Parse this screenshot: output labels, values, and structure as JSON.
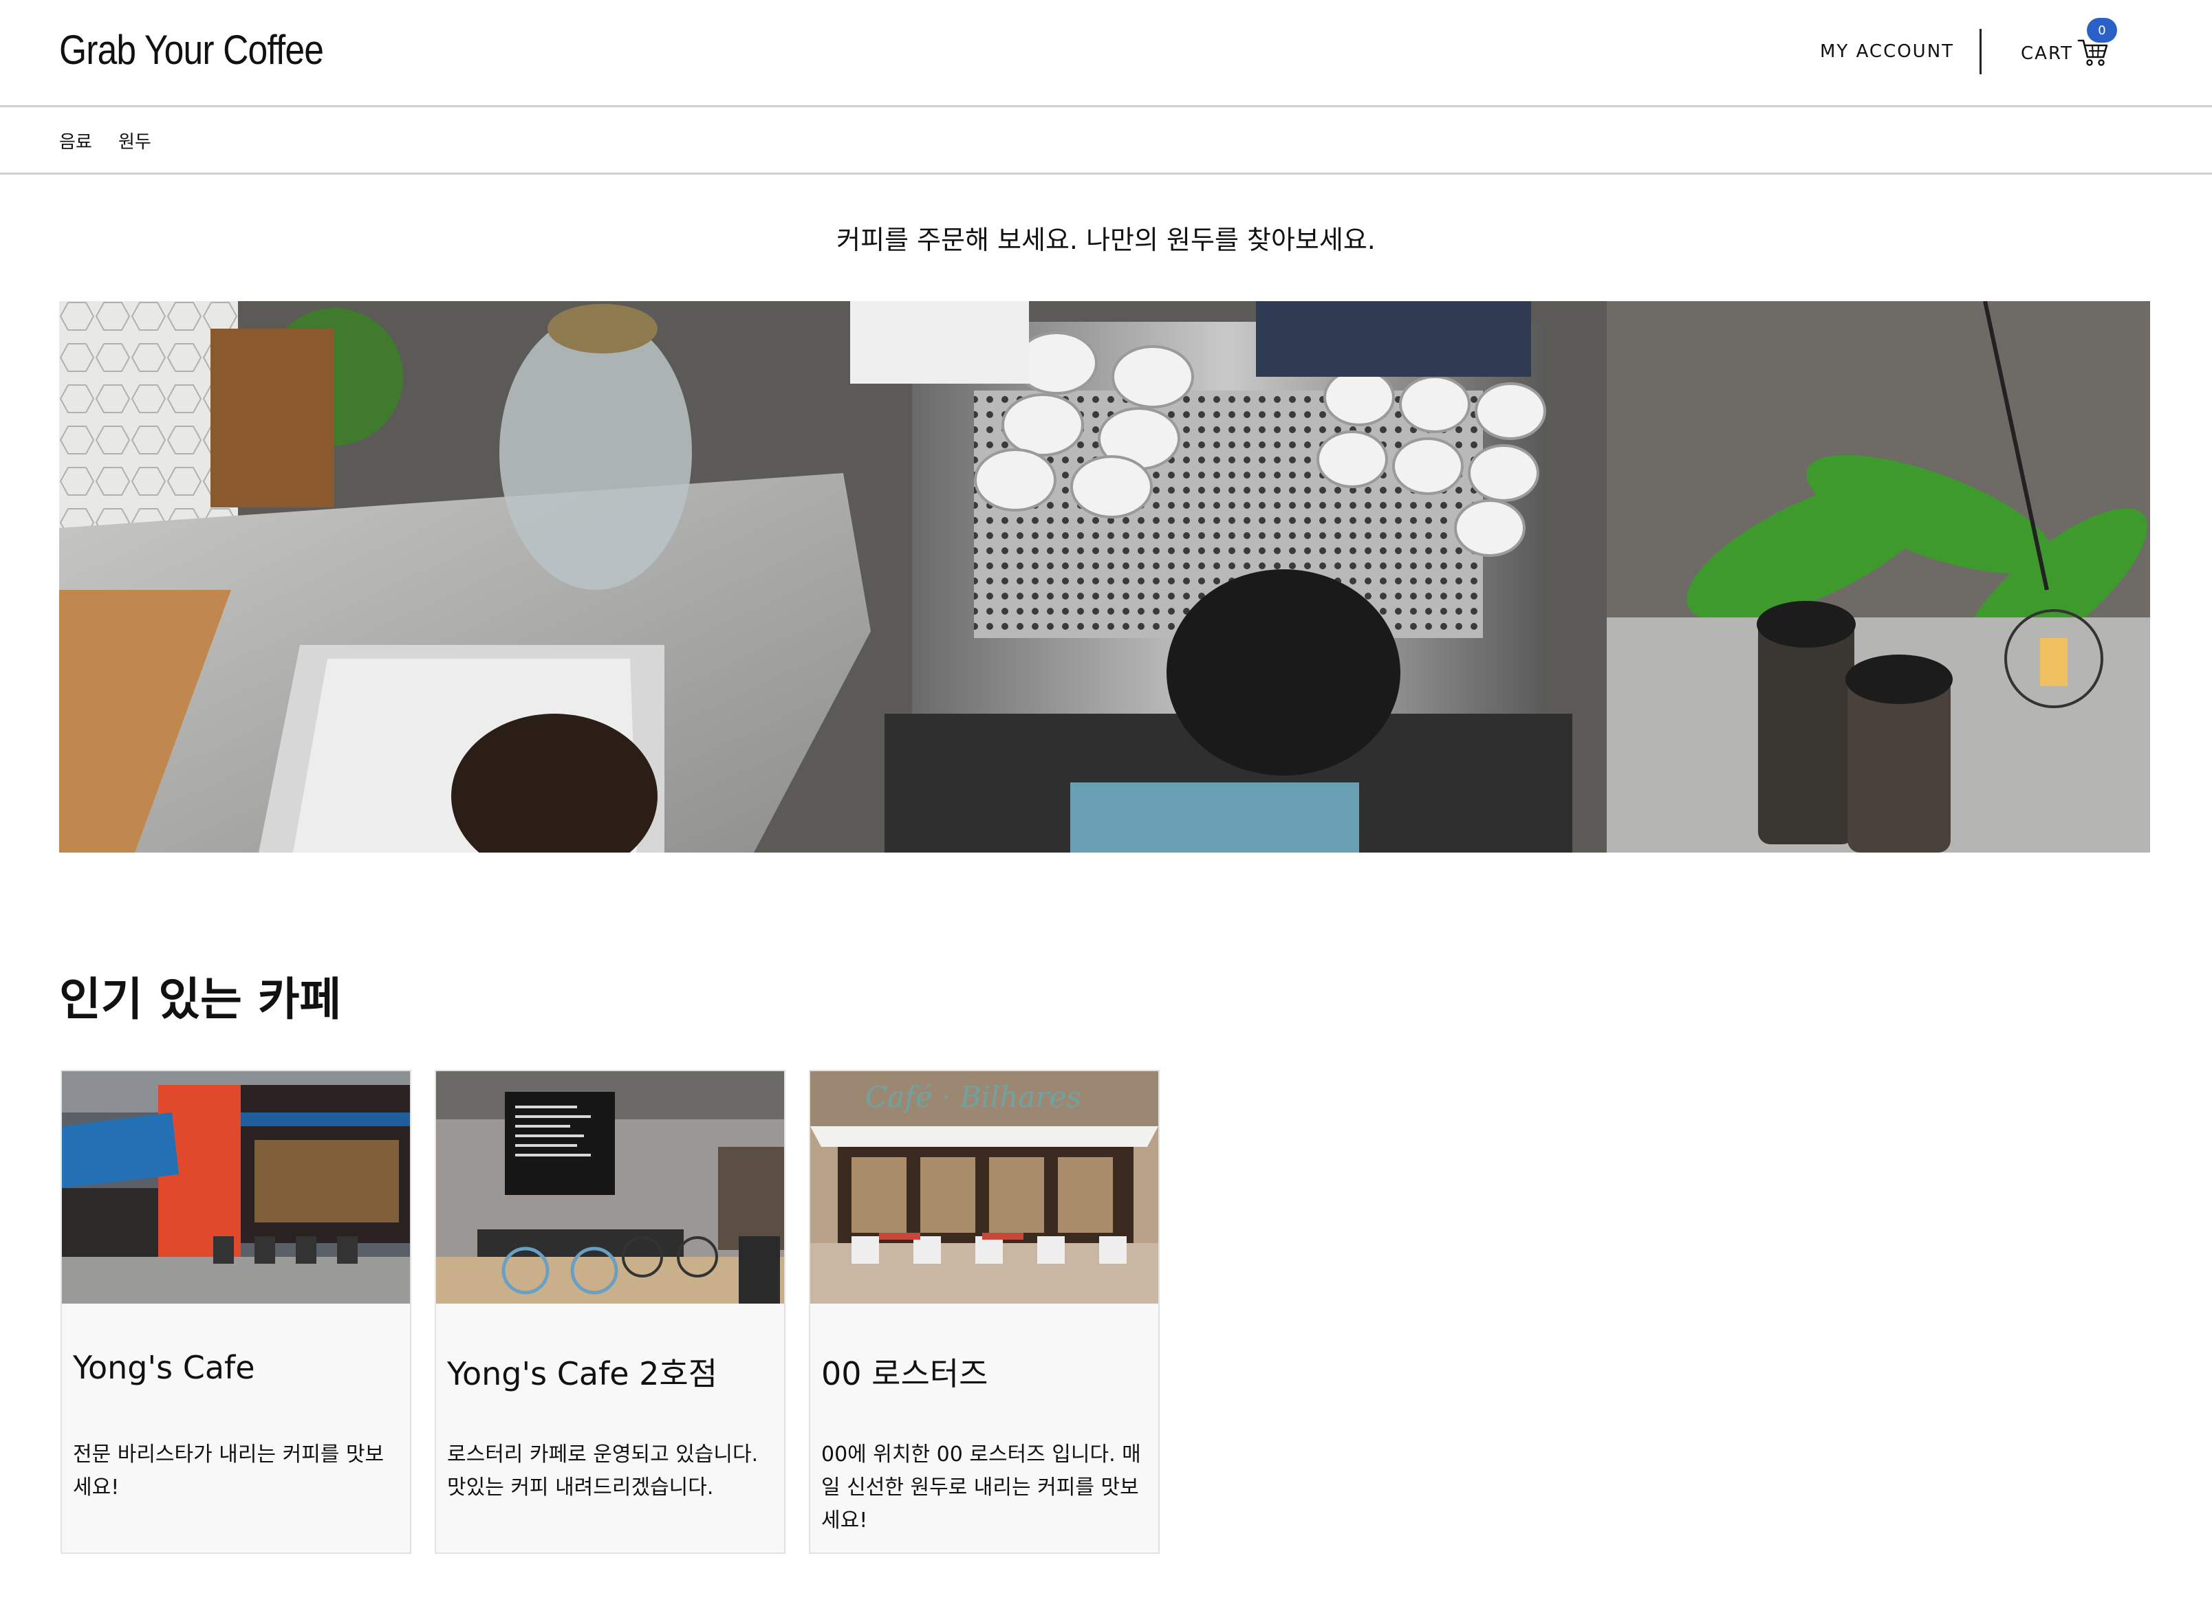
{
  "header": {
    "logo": "Grab Your Coffee",
    "account_label": "MY ACCOUNT",
    "cart_label": "CART",
    "cart_count": "0"
  },
  "nav": {
    "items": [
      {
        "label": "음료"
      },
      {
        "label": "원두"
      }
    ]
  },
  "hero": {
    "tagline": "커피를 주문해 보세요. 나만의 원두를 찾아보세요."
  },
  "popular": {
    "title": "인기 있는 카페",
    "cafes": [
      {
        "name": "Yong's Cafe",
        "description": "전문 바리스타가 내리는 커피를 맛보세요!"
      },
      {
        "name": "Yong's Cafe 2호점",
        "description": "로스터리 카페로 운영되고 있습니다. 맛있는 커피 내려드리겠습니다."
      },
      {
        "name": "00 로스터즈",
        "description": "00에 위치한 00 로스터즈 입니다. 매일 신선한 원두로 내리는 커피를 맛보세요!"
      }
    ]
  },
  "colors": {
    "accent": "#2a61c6",
    "border": "#d0d0d0",
    "card_bg": "#f8f8f8"
  }
}
